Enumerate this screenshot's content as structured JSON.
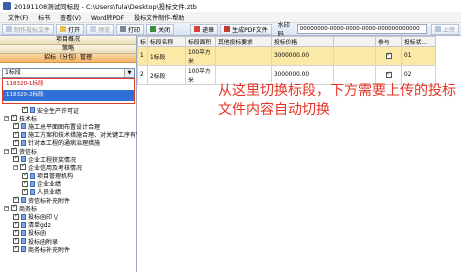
{
  "window": {
    "title": "20191108测试同标段 - C:\\Users\\fula\\Desktop\\投标文件.ztb"
  },
  "menu": [
    "文件(F)",
    "标书",
    "查看(V)",
    "Word转PDF",
    "投标文件制作-帮助"
  ],
  "toolbar": {
    "make_bid": "制作投标文件",
    "open": "打开",
    "preview": "预览",
    "print": "打印",
    "close": "关闭",
    "submit": "递章",
    "gen_pdf": "生成PDF文件",
    "verify_label": "水印码",
    "verify_value": "00000000-0000-0000-0000-000000000000",
    "upload": "上传"
  },
  "left": {
    "panels": [
      "项目概况",
      "策略",
      "招标（分包）管理"
    ],
    "dropdown_value": "1标段",
    "dropdown_options": [
      "118320-1标段",
      "118320-2标段"
    ],
    "tree": [
      {
        "label": "安全生产许可证",
        "level": 2,
        "checked": true,
        "type": "doc"
      },
      {
        "label": "技术标",
        "level": 0,
        "checked": true,
        "type": "folder"
      },
      {
        "label": "施工总平面图布置设计合理",
        "level": 1,
        "checked": true,
        "type": "doc"
      },
      {
        "label": "施工方案和技术措施合理、对关键工序有针",
        "level": 1,
        "checked": true,
        "type": "doc"
      },
      {
        "label": "针对本工程的通病治理措施",
        "level": 1,
        "checked": true,
        "type": "doc"
      },
      {
        "label": "资信标",
        "level": 0,
        "checked": true,
        "type": "folder"
      },
      {
        "label": "企业工程获奖情况",
        "level": 1,
        "checked": true,
        "type": "doc"
      },
      {
        "label": "企业信用及考核情况",
        "level": 1,
        "checked": true,
        "type": "folder"
      },
      {
        "label": "项目管理机构",
        "level": 2,
        "checked": true,
        "type": "doc"
      },
      {
        "label": "企业业绩",
        "level": 2,
        "checked": true,
        "type": "doc"
      },
      {
        "label": "人员业绩",
        "level": 2,
        "checked": true,
        "type": "doc"
      },
      {
        "label": "资信标补充附件",
        "level": 1,
        "checked": true,
        "type": "doc"
      },
      {
        "label": "商务标",
        "level": 0,
        "checked": true,
        "type": "folder"
      },
      {
        "label": "投标函印 \\/",
        "level": 1,
        "checked": true,
        "type": "doc"
      },
      {
        "label": "清单gdz",
        "level": 1,
        "checked": true,
        "type": "doc"
      },
      {
        "label": "投标函",
        "level": 1,
        "checked": true,
        "type": "doc"
      },
      {
        "label": "投标函附录",
        "level": 1,
        "checked": true,
        "type": "doc"
      },
      {
        "label": "商务标补充附件",
        "level": 1,
        "checked": true,
        "type": "doc"
      }
    ]
  },
  "grid": {
    "headers": [
      "标",
      "标段名称",
      "标段面积",
      "其他投标要求",
      "投标价格",
      "",
      "参与",
      "投标状..."
    ],
    "rows": [
      [
        "1",
        "1标段",
        "100平方米",
        "",
        "3000000.00",
        "",
        "✓",
        "01"
      ],
      [
        "2",
        "2标段",
        "100平方米",
        "",
        "3000000.00",
        "",
        "✓",
        "02"
      ]
    ]
  },
  "annotation": "从这里切换标段，下方需要上传的投标文件内容自动切换"
}
